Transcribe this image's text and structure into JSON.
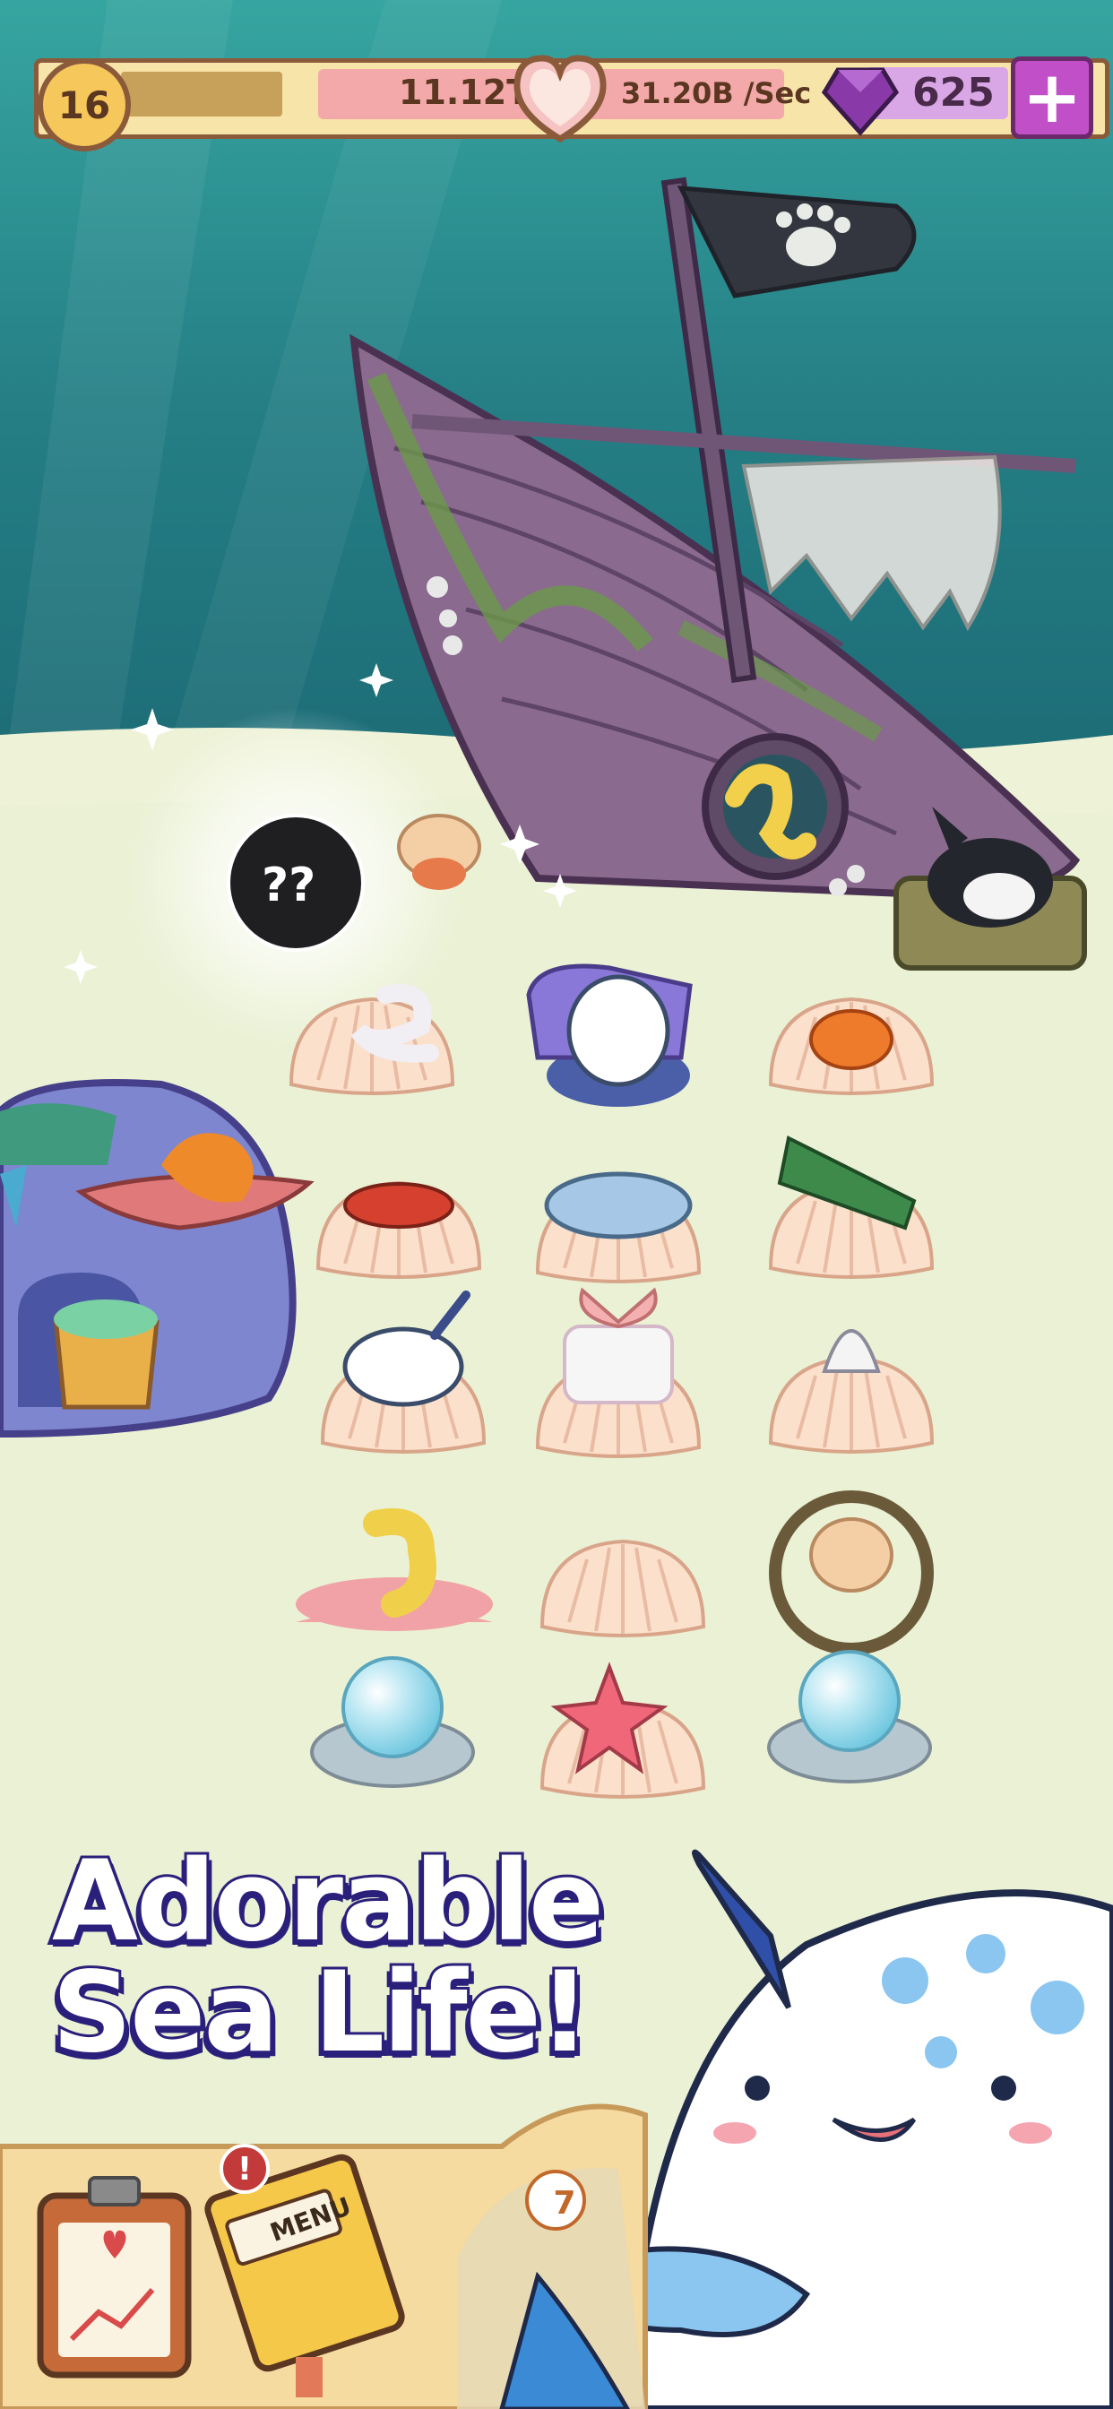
{
  "hud": {
    "level": "16",
    "xp_progress": 0.0,
    "coins": "11.12T",
    "rate": "31.20B /Sec",
    "gems": "625",
    "add_gems_symbol": "+"
  },
  "mystery_bubble": {
    "label": "??"
  },
  "headline": {
    "line1": "Adorable",
    "line2": "Sea Life!"
  },
  "bottom_menu": {
    "menu_label": "MENU",
    "alert_symbol": "!",
    "timer_value": "7"
  },
  "colors": {
    "sea_top": "#2f9a9a",
    "sea_bottom": "#1e6f79",
    "sand": "#eaf1d4",
    "hud_cream": "#f7e4a8",
    "accent_purple": "#c14fc8",
    "headline_outline": "#2a1f7a"
  },
  "icons": [
    "level-star-icon",
    "heart-icon",
    "gem-icon",
    "plus-icon",
    "clipboard-stats-icon",
    "menu-book-icon",
    "alert-icon",
    "pirate-paw-flag-icon"
  ]
}
